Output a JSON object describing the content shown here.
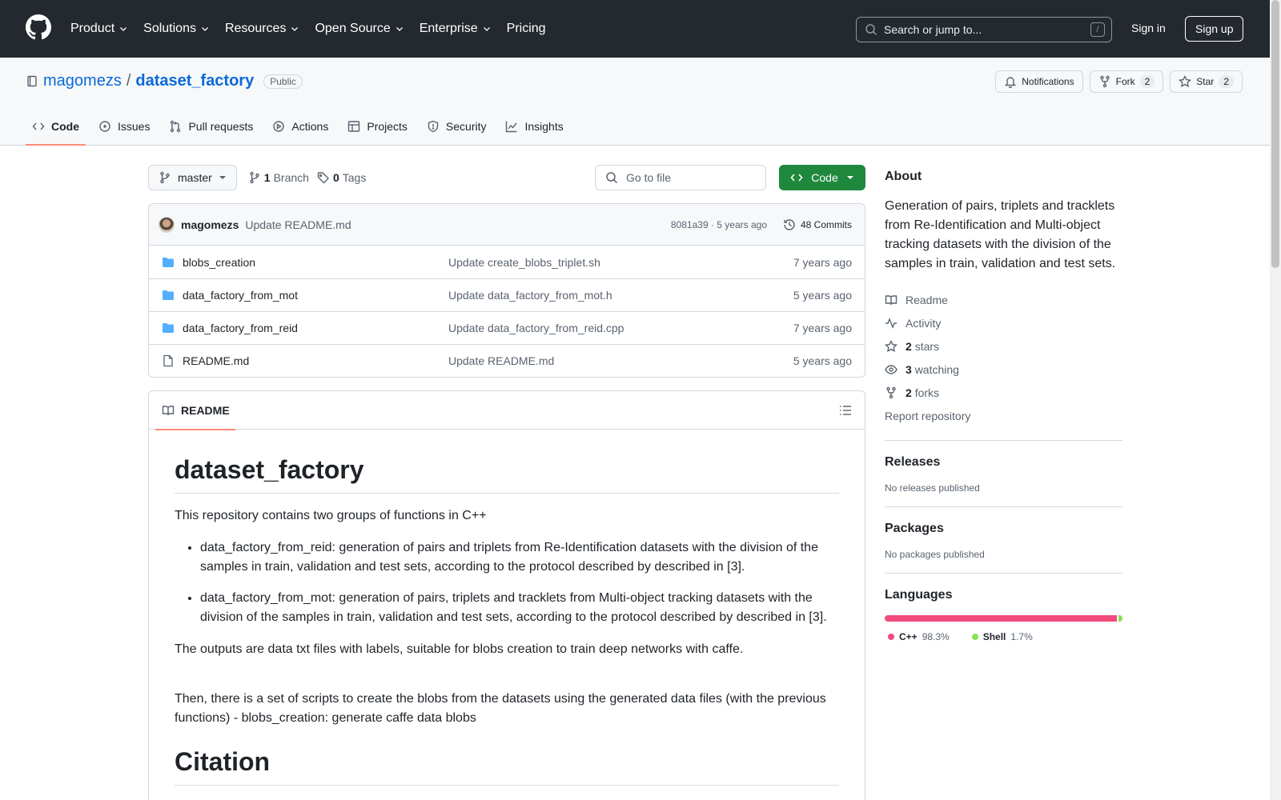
{
  "header": {
    "nav": [
      {
        "label": "Product",
        "has_caret": true
      },
      {
        "label": "Solutions",
        "has_caret": true
      },
      {
        "label": "Resources",
        "has_caret": true
      },
      {
        "label": "Open Source",
        "has_caret": true
      },
      {
        "label": "Enterprise",
        "has_caret": true
      },
      {
        "label": "Pricing",
        "has_caret": false
      }
    ],
    "search_placeholder": "Search or jump to...",
    "search_shortcut": "/",
    "sign_in": "Sign in",
    "sign_up": "Sign up"
  },
  "repo": {
    "owner": "magomezs",
    "separator": "/",
    "name": "dataset_factory",
    "visibility": "Public",
    "actions": {
      "notifications": "Notifications",
      "fork": "Fork",
      "fork_count": "2",
      "star": "Star",
      "star_count": "2"
    },
    "tabs": [
      {
        "label": "Code",
        "icon": "code-icon",
        "active": true
      },
      {
        "label": "Issues",
        "icon": "issue-icon",
        "active": false
      },
      {
        "label": "Pull requests",
        "icon": "pull-request-icon",
        "active": false
      },
      {
        "label": "Actions",
        "icon": "play-icon",
        "active": false
      },
      {
        "label": "Projects",
        "icon": "table-icon",
        "active": false
      },
      {
        "label": "Security",
        "icon": "shield-icon",
        "active": false
      },
      {
        "label": "Insights",
        "icon": "graph-icon",
        "active": false
      }
    ]
  },
  "toolbar": {
    "branch": "master",
    "branch_count": "1",
    "branch_label": "Branch",
    "tag_count": "0",
    "tag_label": "Tags",
    "goto_file": "Go to file",
    "code_button": "Code"
  },
  "commit": {
    "author": "magomezs",
    "message": "Update README.md",
    "sha_time": "8081a39 · 5 years ago",
    "count": "48 Commits"
  },
  "files": [
    {
      "name": "blobs_creation",
      "type": "folder",
      "message": "Update create_blobs_triplet.sh",
      "date": "7 years ago"
    },
    {
      "name": "data_factory_from_mot",
      "type": "folder",
      "message": "Update data_factory_from_mot.h",
      "date": "5 years ago"
    },
    {
      "name": "data_factory_from_reid",
      "type": "folder",
      "message": "Update data_factory_from_reid.cpp",
      "date": "7 years ago"
    },
    {
      "name": "README.md",
      "type": "file",
      "message": "Update README.md",
      "date": "5 years ago"
    }
  ],
  "readme": {
    "tab": "README",
    "title": "dataset_factory",
    "intro": "This repository contains two groups of functions in C++",
    "bullets": [
      "data_factory_from_reid: generation of pairs and triplets from Re-Identification datasets with the division of the samples in train, validation and test sets, according to the protocol described by described in [3].",
      "data_factory_from_mot: generation of pairs, triplets and tracklets from Multi-object tracking datasets with the division of the samples in train, validation and test sets, according to the protocol described by described in [3]."
    ],
    "outputs": "The outputs are data txt files with labels, suitable for blobs creation to train deep networks with caffe.",
    "then": "Then, there is a set of scripts to create the blobs from the datasets using the generated data files (with the previous functions) - blobs_creation: generate caffe data blobs",
    "citation_heading": "Citation"
  },
  "sidebar": {
    "about_heading": "About",
    "about_text": "Generation of pairs, triplets and tracklets from Re-Identification and Multi-object tracking datasets with the division of the samples in train, validation and test sets.",
    "links": [
      {
        "icon": "book-icon",
        "bold": "",
        "label": "Readme"
      },
      {
        "icon": "pulse-icon",
        "bold": "",
        "label": "Activity"
      },
      {
        "icon": "star-icon",
        "bold": "2",
        "label": "stars"
      },
      {
        "icon": "eye-icon",
        "bold": "3",
        "label": "watching"
      },
      {
        "icon": "fork-icon",
        "bold": "2",
        "label": "forks"
      }
    ],
    "report": "Report repository",
    "releases_heading": "Releases",
    "releases_text": "No releases published",
    "packages_heading": "Packages",
    "packages_text": "No packages published",
    "languages_heading": "Languages",
    "languages": [
      {
        "name": "C++",
        "percent": "98.3%",
        "value": 98.3,
        "color": "#f34b7d"
      },
      {
        "name": "Shell",
        "percent": "1.7%",
        "value": 1.7,
        "color": "#89e051"
      }
    ]
  }
}
